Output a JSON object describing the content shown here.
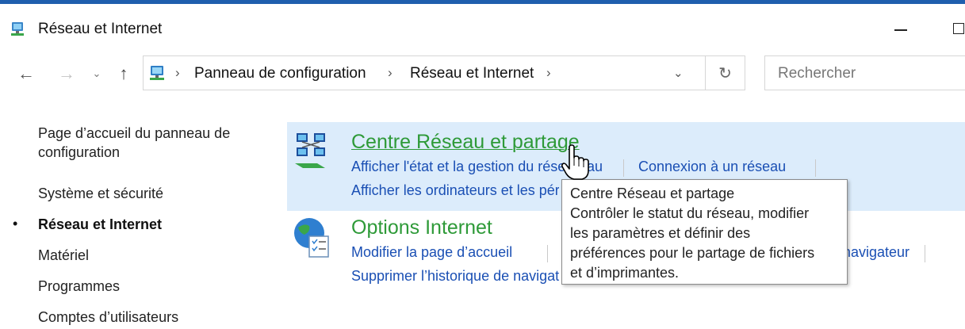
{
  "window": {
    "title": "Réseau et Internet",
    "title_icon": "network-folder-icon",
    "minimize_icon": "minimize-icon",
    "maximize_icon": "maximize-icon"
  },
  "nav": {
    "back_icon": "arrow-left-icon",
    "forward_icon": "arrow-right-icon",
    "recent_icon": "chevron-down-icon",
    "up_icon": "arrow-up-icon",
    "refresh_icon": "refresh-icon"
  },
  "address": {
    "icon": "control-panel-icon",
    "crumbs": [
      "Panneau de configuration",
      "Réseau et Internet"
    ],
    "separator": "›"
  },
  "search": {
    "placeholder": "Rechercher",
    "value": ""
  },
  "sidebar": {
    "items": [
      {
        "label": "Page d’accueil du panneau de configuration",
        "active": false
      },
      {
        "label": "Système et sécurité",
        "active": false
      },
      {
        "label": "Réseau et Internet",
        "active": true
      },
      {
        "label": "Matériel",
        "active": false
      },
      {
        "label": "Programmes",
        "active": false
      },
      {
        "label": "Comptes d’utilisateurs",
        "active": false
      }
    ],
    "bullet": "•"
  },
  "categories": [
    {
      "title": "Centre Réseau et partage",
      "icon": "network-center-icon",
      "tasks": [
        "Afficher l'état et la gestion du réseau",
        "Connexion à un réseau",
        "Afficher les ordinateurs et les périphériques réseau"
      ]
    },
    {
      "title": "Options Internet",
      "icon": "internet-options-icon",
      "tasks": [
        "Modifier la page d’accueil",
        "Gérer les modules complémentaires du navigateur",
        "Supprimer l’historique de navigation et les cookies"
      ]
    }
  ],
  "tooltip": {
    "lines": [
      "Centre Réseau et partage",
      "Contrôler le statut du réseau, modifier",
      "les paramètres et définir des",
      "préférences pour le partage de fichiers",
      "et d’imprimantes."
    ]
  },
  "colors": {
    "accent_border": "#1f5fae",
    "hover_background": "#dcecfb",
    "category_title": "#2e9a38",
    "task_link": "#1a4fb4"
  }
}
